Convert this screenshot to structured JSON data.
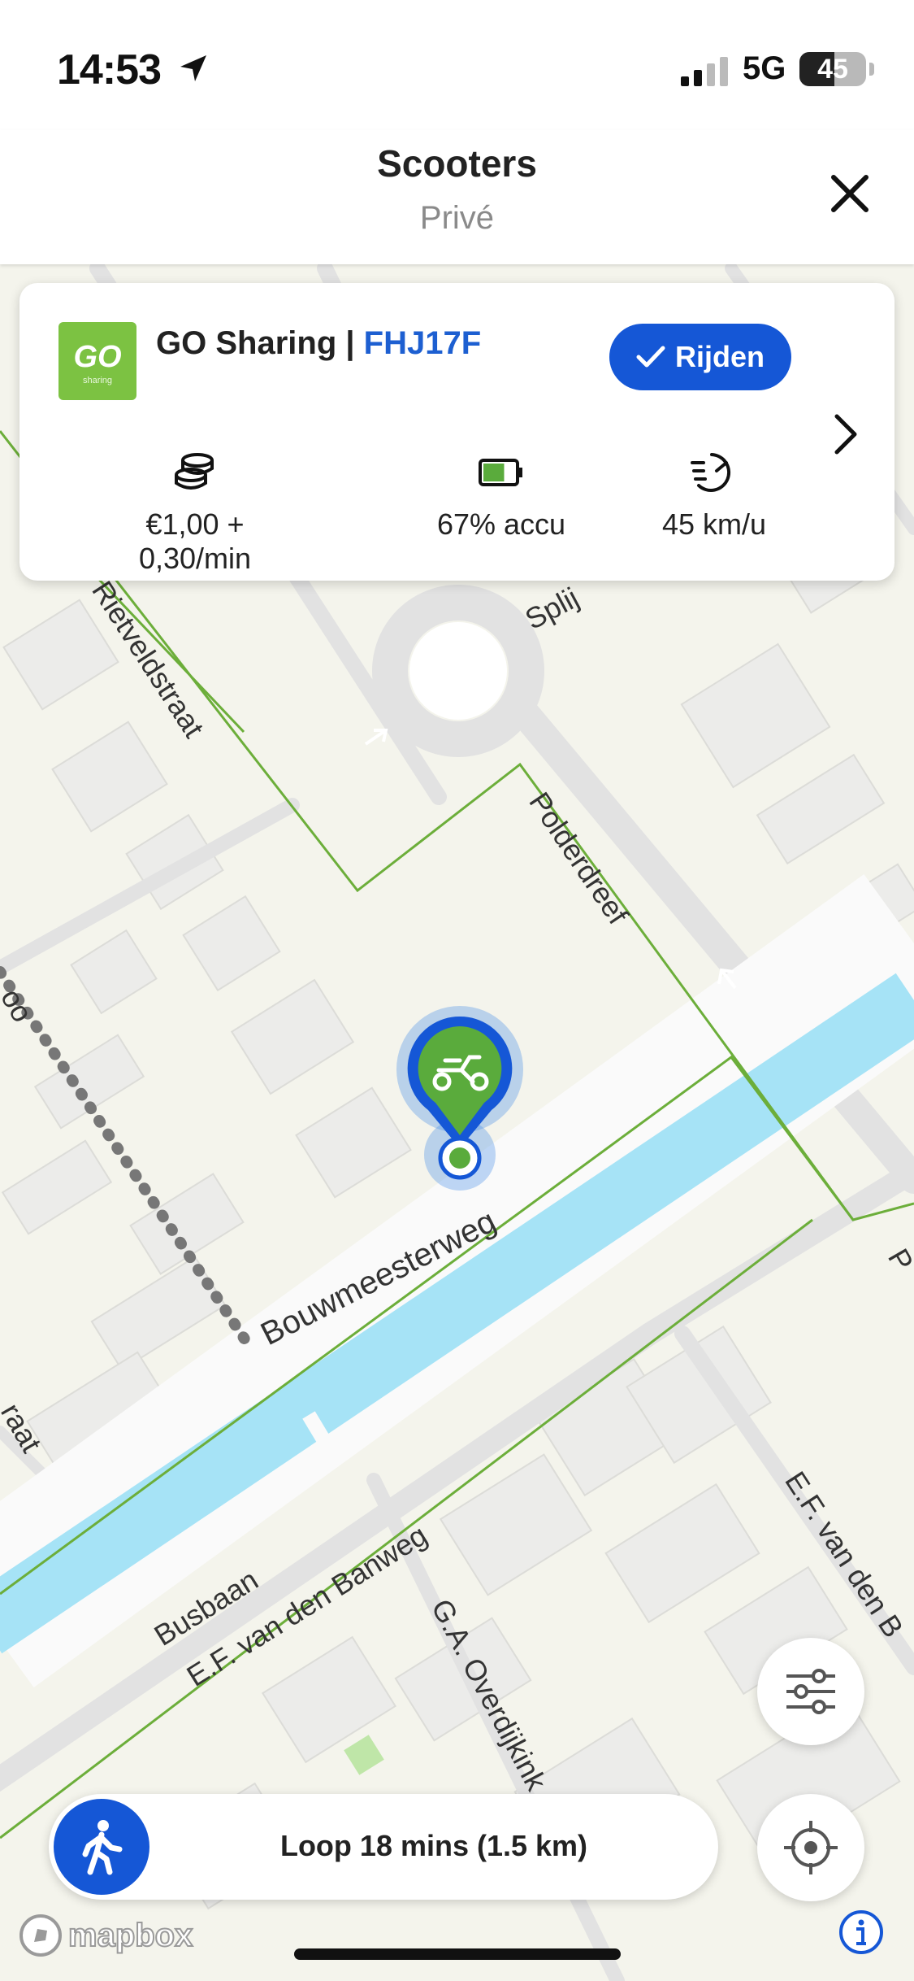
{
  "status_bar": {
    "time": "14:53",
    "network": "5G",
    "battery": "45"
  },
  "header": {
    "title": "Scooters",
    "subtitle": "Privé"
  },
  "vehicle_card": {
    "logo_text": "GO",
    "logo_sub": "sharing",
    "provider": "GO Sharing",
    "separator": " | ",
    "plate": "FHJ17F",
    "ride_button": "Rijden",
    "price": "€1,00 + 0,30/min",
    "battery": "67% accu",
    "battery_level": 0.67,
    "speed": "45 km/u",
    "icons": {
      "price": "coins-icon",
      "battery": "battery-icon",
      "speed": "speedometer-icon"
    }
  },
  "map": {
    "streets": [
      "Rietveldstraat",
      "Polderdreef",
      "Splij",
      "Bouwmeesterweg",
      "Busbaan",
      "E.F. van den Banweg",
      "G.A. Overdijkink",
      "E.F. van den B",
      "P",
      "raat",
      "oo"
    ],
    "colors": {
      "land": "#f4f4ec",
      "water": "#a6e3f6",
      "road": "#e2e2e2",
      "boundary": "#6cae3a",
      "marker": "#5aab3c",
      "accent": "#1557d6"
    }
  },
  "walk_bar": {
    "label": "Loop 18 mins (1.5 km)"
  },
  "attribution": "mapbox"
}
